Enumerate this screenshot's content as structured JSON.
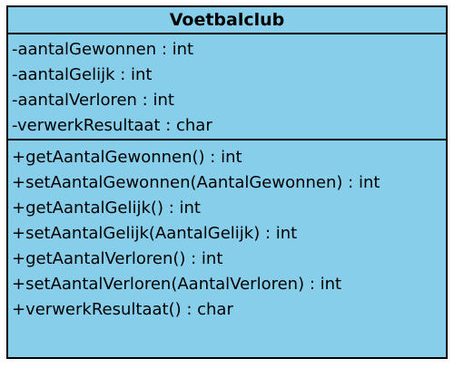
{
  "uml_class": {
    "name": "Voetbalclub",
    "fill_color": "#87CEEB",
    "attributes": [
      "-aantalGewonnen : int",
      "-aantalGelijk : int",
      "-aantalVerloren : int",
      "-verwerkResultaat : char"
    ],
    "methods": [
      "+getAantalGewonnen() : int",
      "+setAantalGewonnen(AantalGewonnen) : int",
      "+getAantalGelijk() : int",
      "+setAantalGelijk(AantalGelijk) : int",
      "+getAantalVerloren() : int",
      "+setAantalVerloren(AantalVerloren) : int",
      "+verwerkResultaat() : char"
    ]
  }
}
